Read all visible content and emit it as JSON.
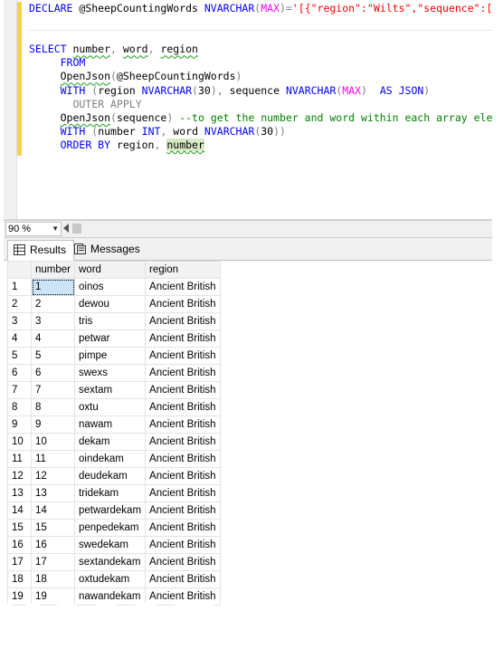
{
  "editor": {
    "lines": [
      {
        "segments": [
          {
            "t": "DECLARE ",
            "c": "kw"
          },
          {
            "t": "@SheepCountingWords ",
            "c": ""
          },
          {
            "t": "NVARCHAR",
            "c": "kw"
          },
          {
            "t": "(",
            "c": "gr"
          },
          {
            "t": "MAX",
            "c": "fn"
          },
          {
            "t": ")=",
            "c": "gr"
          },
          {
            "t": "'[{\"region\":\"Wilts\",\"sequence\":[{\"num",
            "c": "str"
          }
        ]
      },
      {
        "segments": []
      },
      {
        "segments": []
      },
      {
        "segments": [
          {
            "t": "SELECT ",
            "c": "kw"
          },
          {
            "t": "number",
            "c": "wavy"
          },
          {
            "t": ", ",
            "c": "gr"
          },
          {
            "t": "word",
            "c": "wavy"
          },
          {
            "t": ", ",
            "c": "gr"
          },
          {
            "t": "region",
            "c": "wavy"
          }
        ]
      },
      {
        "segments": [
          {
            "t": "     FROM",
            "c": "kw"
          }
        ]
      },
      {
        "segments": [
          {
            "t": "     ",
            "c": ""
          },
          {
            "t": "OpenJson",
            "c": "wavy"
          },
          {
            "t": "(",
            "c": "gr"
          },
          {
            "t": "@SheepCountingWords",
            "c": ""
          },
          {
            "t": ")",
            "c": "gr"
          }
        ]
      },
      {
        "segments": [
          {
            "t": "     ",
            "c": ""
          },
          {
            "t": "WITH ",
            "c": "kw"
          },
          {
            "t": "(",
            "c": "gr"
          },
          {
            "t": "region ",
            "c": ""
          },
          {
            "t": "NVARCHAR",
            "c": "kw"
          },
          {
            "t": "(",
            "c": "gr"
          },
          {
            "t": "30",
            "c": ""
          },
          {
            "t": "), ",
            "c": "gr"
          },
          {
            "t": "sequence ",
            "c": ""
          },
          {
            "t": "NVARCHAR",
            "c": "kw"
          },
          {
            "t": "(",
            "c": "gr"
          },
          {
            "t": "MAX",
            "c": "fn"
          },
          {
            "t": ")  ",
            "c": "gr"
          },
          {
            "t": "AS JSON",
            "c": "kw"
          },
          {
            "t": ")",
            "c": "gr"
          }
        ]
      },
      {
        "segments": [
          {
            "t": "       OUTER APPLY",
            "c": "gr"
          }
        ]
      },
      {
        "segments": [
          {
            "t": "     ",
            "c": ""
          },
          {
            "t": "OpenJson",
            "c": "wavy"
          },
          {
            "t": "(",
            "c": "gr"
          },
          {
            "t": "sequence",
            "c": ""
          },
          {
            "t": ") ",
            "c": "gr"
          },
          {
            "t": "--to get the number and word within each array element",
            "c": "cm"
          }
        ]
      },
      {
        "segments": [
          {
            "t": "     ",
            "c": ""
          },
          {
            "t": "WITH ",
            "c": "kw"
          },
          {
            "t": "(",
            "c": "gr"
          },
          {
            "t": "number ",
            "c": ""
          },
          {
            "t": "INT",
            "c": "kw"
          },
          {
            "t": ", ",
            "c": "gr"
          },
          {
            "t": "word ",
            "c": ""
          },
          {
            "t": "NVARCHAR",
            "c": "kw"
          },
          {
            "t": "(",
            "c": "gr"
          },
          {
            "t": "30",
            "c": ""
          },
          {
            "t": "))",
            "c": "gr"
          }
        ]
      },
      {
        "segments": [
          {
            "t": "     ",
            "c": ""
          },
          {
            "t": "ORDER BY ",
            "c": "kw"
          },
          {
            "t": "region",
            "c": ""
          },
          {
            "t": ", ",
            "c": "gr"
          },
          {
            "t": "number",
            "c": "hl wavy"
          }
        ]
      }
    ]
  },
  "statusbar": {
    "zoom": "90 %"
  },
  "tabs": [
    {
      "label": "Results",
      "active": true
    },
    {
      "label": "Messages",
      "active": false
    }
  ],
  "grid": {
    "columns": [
      "number",
      "word",
      "region"
    ],
    "rows": [
      [
        "1",
        "1",
        "oinos",
        "Ancient British"
      ],
      [
        "2",
        "2",
        "dewou",
        "Ancient British"
      ],
      [
        "3",
        "3",
        "tris",
        "Ancient British"
      ],
      [
        "4",
        "4",
        "petwar",
        "Ancient British"
      ],
      [
        "5",
        "5",
        "pimpe",
        "Ancient British"
      ],
      [
        "6",
        "6",
        "swexs",
        "Ancient British"
      ],
      [
        "7",
        "7",
        "sextam",
        "Ancient British"
      ],
      [
        "8",
        "8",
        "oxtu",
        "Ancient British"
      ],
      [
        "9",
        "9",
        "nawam",
        "Ancient British"
      ],
      [
        "10",
        "10",
        "dekam",
        "Ancient British"
      ],
      [
        "11",
        "11",
        "oindekam",
        "Ancient British"
      ],
      [
        "12",
        "12",
        "deudekam",
        "Ancient British"
      ],
      [
        "13",
        "13",
        "tridekam",
        "Ancient British"
      ],
      [
        "14",
        "14",
        "petwardekam",
        "Ancient British"
      ],
      [
        "15",
        "15",
        "penpedekam",
        "Ancient British"
      ],
      [
        "16",
        "16",
        "swedekam",
        "Ancient British"
      ],
      [
        "17",
        "17",
        "sextandekam",
        "Ancient British"
      ],
      [
        "18",
        "18",
        "oxtudekam",
        "Ancient British"
      ],
      [
        "19",
        "19",
        "nawandekam",
        "Ancient British"
      ]
    ]
  }
}
